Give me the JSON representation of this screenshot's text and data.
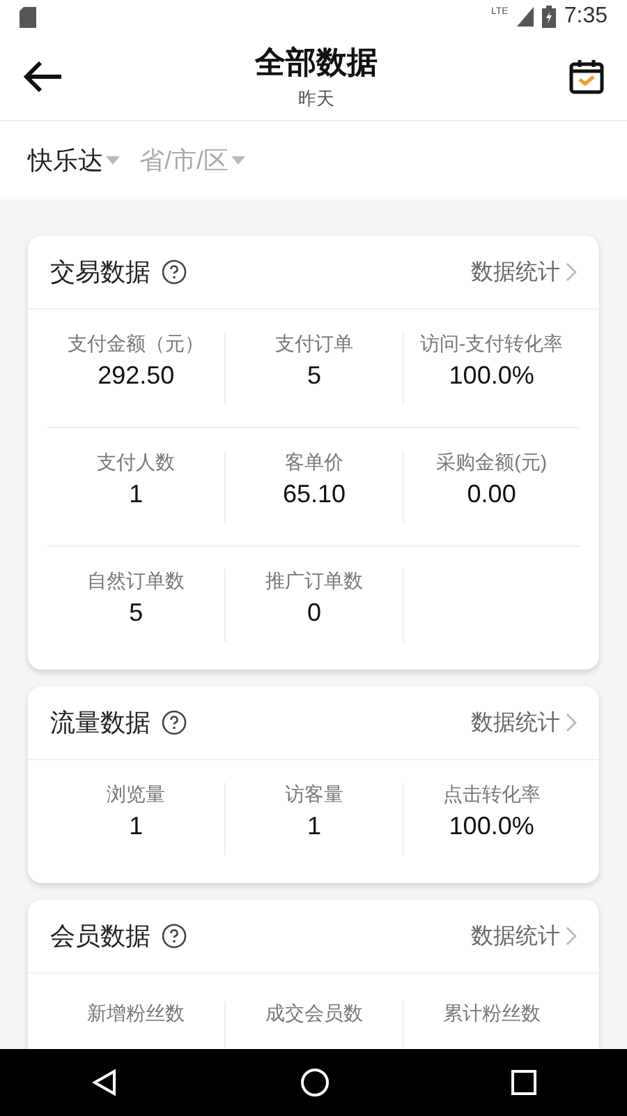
{
  "status_bar": {
    "network": "LTE",
    "time": "7:35"
  },
  "header": {
    "title": "全部数据",
    "subtitle": "昨天"
  },
  "filters": [
    {
      "value": "快乐达"
    },
    {
      "placeholder": "省/市/区"
    }
  ],
  "cards": [
    {
      "title": "交易数据",
      "link": "数据统计",
      "rows": [
        [
          {
            "label": "支付金额（元）",
            "value": "292.50"
          },
          {
            "label": "支付订单",
            "value": "5"
          },
          {
            "label": "访问-支付转化率",
            "value": "100.0%"
          }
        ],
        [
          {
            "label": "支付人数",
            "value": "1"
          },
          {
            "label": "客单价",
            "value": "65.10"
          },
          {
            "label": "采购金额(元)",
            "value": "0.00"
          }
        ],
        [
          {
            "label": "自然订单数",
            "value": "5"
          },
          {
            "label": "推广订单数",
            "value": "0"
          }
        ]
      ]
    },
    {
      "title": "流量数据",
      "link": "数据统计",
      "rows": [
        [
          {
            "label": "浏览量",
            "value": "1"
          },
          {
            "label": "访客量",
            "value": "1"
          },
          {
            "label": "点击转化率",
            "value": "100.0%"
          }
        ]
      ]
    },
    {
      "title": "会员数据",
      "link": "数据统计",
      "rows": [
        [
          {
            "label": "新增粉丝数"
          },
          {
            "label": "成交会员数"
          },
          {
            "label": "累计粉丝数"
          }
        ]
      ]
    }
  ]
}
